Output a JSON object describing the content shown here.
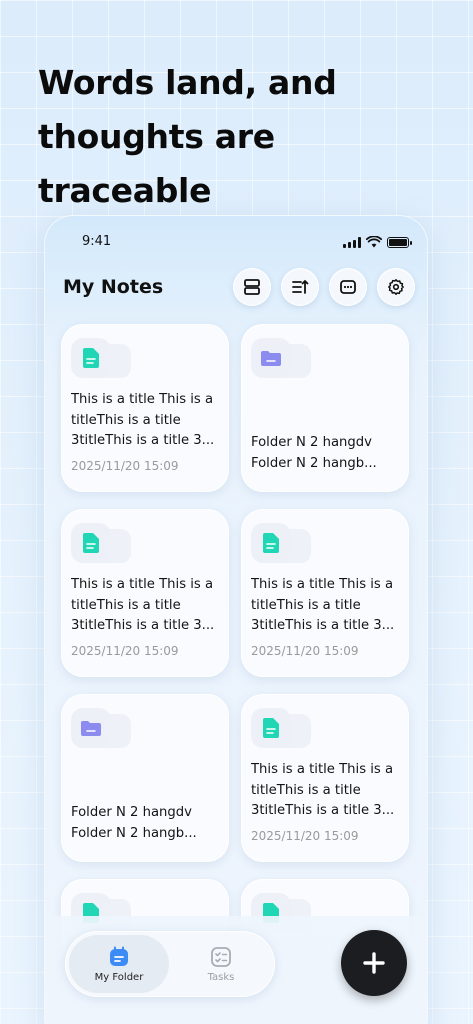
{
  "headline": {
    "line1": "Words land, and",
    "line2": "thoughts are traceable"
  },
  "status_bar": {
    "time": "9:41",
    "icons": [
      "signal-icon",
      "wifi-icon",
      "battery-icon"
    ]
  },
  "header": {
    "title": "My Notes",
    "actions": [
      "layout-icon",
      "sort-icon",
      "more-icon",
      "settings-icon"
    ]
  },
  "notes": [
    {
      "kind": "note",
      "icon": "note-file-icon",
      "text": "This is a title This is a titleThis is a title 3titleThis is a title 3...",
      "date": "2025/11/20 15:09"
    },
    {
      "kind": "folder",
      "icon": "folder-icon",
      "text": "Folder N 2 hangdv Folder N 2 hangb...",
      "date": ""
    },
    {
      "kind": "note",
      "icon": "note-file-icon",
      "text": "This is a title This is a titleThis is a title 3titleThis is a title 3...",
      "date": "2025/11/20 15:09"
    },
    {
      "kind": "note",
      "icon": "note-file-icon",
      "text": "This is a title This is a titleThis is a title 3titleThis is a title 3...",
      "date": "2025/11/20 15:09"
    },
    {
      "kind": "folder",
      "icon": "folder-icon",
      "text": "Folder N 2 hangdv Folder N 2 hangb...",
      "date": ""
    },
    {
      "kind": "note",
      "icon": "note-file-icon",
      "text": "This is a title This is a titleThis is a title 3titleThis is a title 3...",
      "date": "2025/11/20 15:09"
    }
  ],
  "nav": {
    "my_folder": "My Folder",
    "tasks": "Tasks"
  },
  "fab": {
    "icon": "plus-icon"
  },
  "colors": {
    "note_accent": "#20d6b4",
    "folder_accent": "#8c8cf0",
    "fab": "#1c1d20"
  }
}
